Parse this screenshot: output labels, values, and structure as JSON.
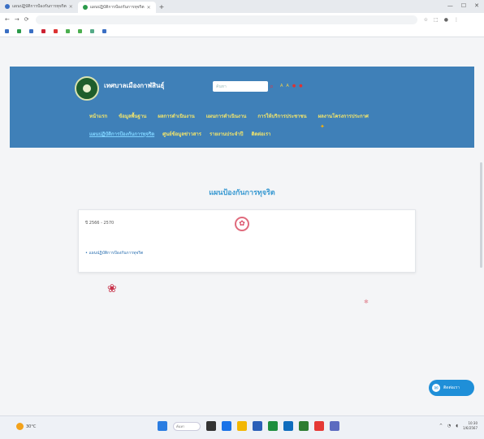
{
  "browser": {
    "tabs": [
      {
        "label": "แผนปฏิบัติการป้องกันการทุจริต"
      },
      {
        "label": "แผนปฏิบัติการป้องกันการทุจริต"
      }
    ],
    "url": "",
    "bookmarks": [
      "",
      "",
      "",
      "",
      "",
      "",
      "",
      "",
      ""
    ]
  },
  "site": {
    "name": "เทศบาลเมืองกาฬสินธุ์",
    "subtitle": "",
    "search_placeholder": "ค้นหา",
    "menu_primary": [
      "หน้าแรก",
      "ข้อมูลพื้นฐาน",
      "ผลการดำเนินงาน",
      "แผนการดำเนินงาน",
      "การให้บริการประชาชน",
      "ผลงานโครงการประกาศ"
    ],
    "menu_secondary": [
      "แผนปฏิบัติการป้องกันการทุจริต",
      "ศูนย์ข้อมูลข่าวสาร",
      "รายงานประจำปี",
      "ติดต่อเรา"
    ]
  },
  "main": {
    "title": "แผนป้องกันการทุจริต",
    "card": {
      "date": "ปี 2566 - 2570",
      "link": "• แผนปฏิบัติการป้องกันการทุจริต"
    }
  },
  "contact_button": {
    "label": "ติดต่อเรา"
  },
  "taskbar": {
    "weather": "30°C",
    "search": "ค้นหา",
    "time": "10:30",
    "date": "1/6/2567"
  },
  "colors": {
    "header_bg": "#3f80b8",
    "menu_text": "#f4e56a",
    "title": "#3a9ad2",
    "contact_button": "#1f8fd8"
  }
}
